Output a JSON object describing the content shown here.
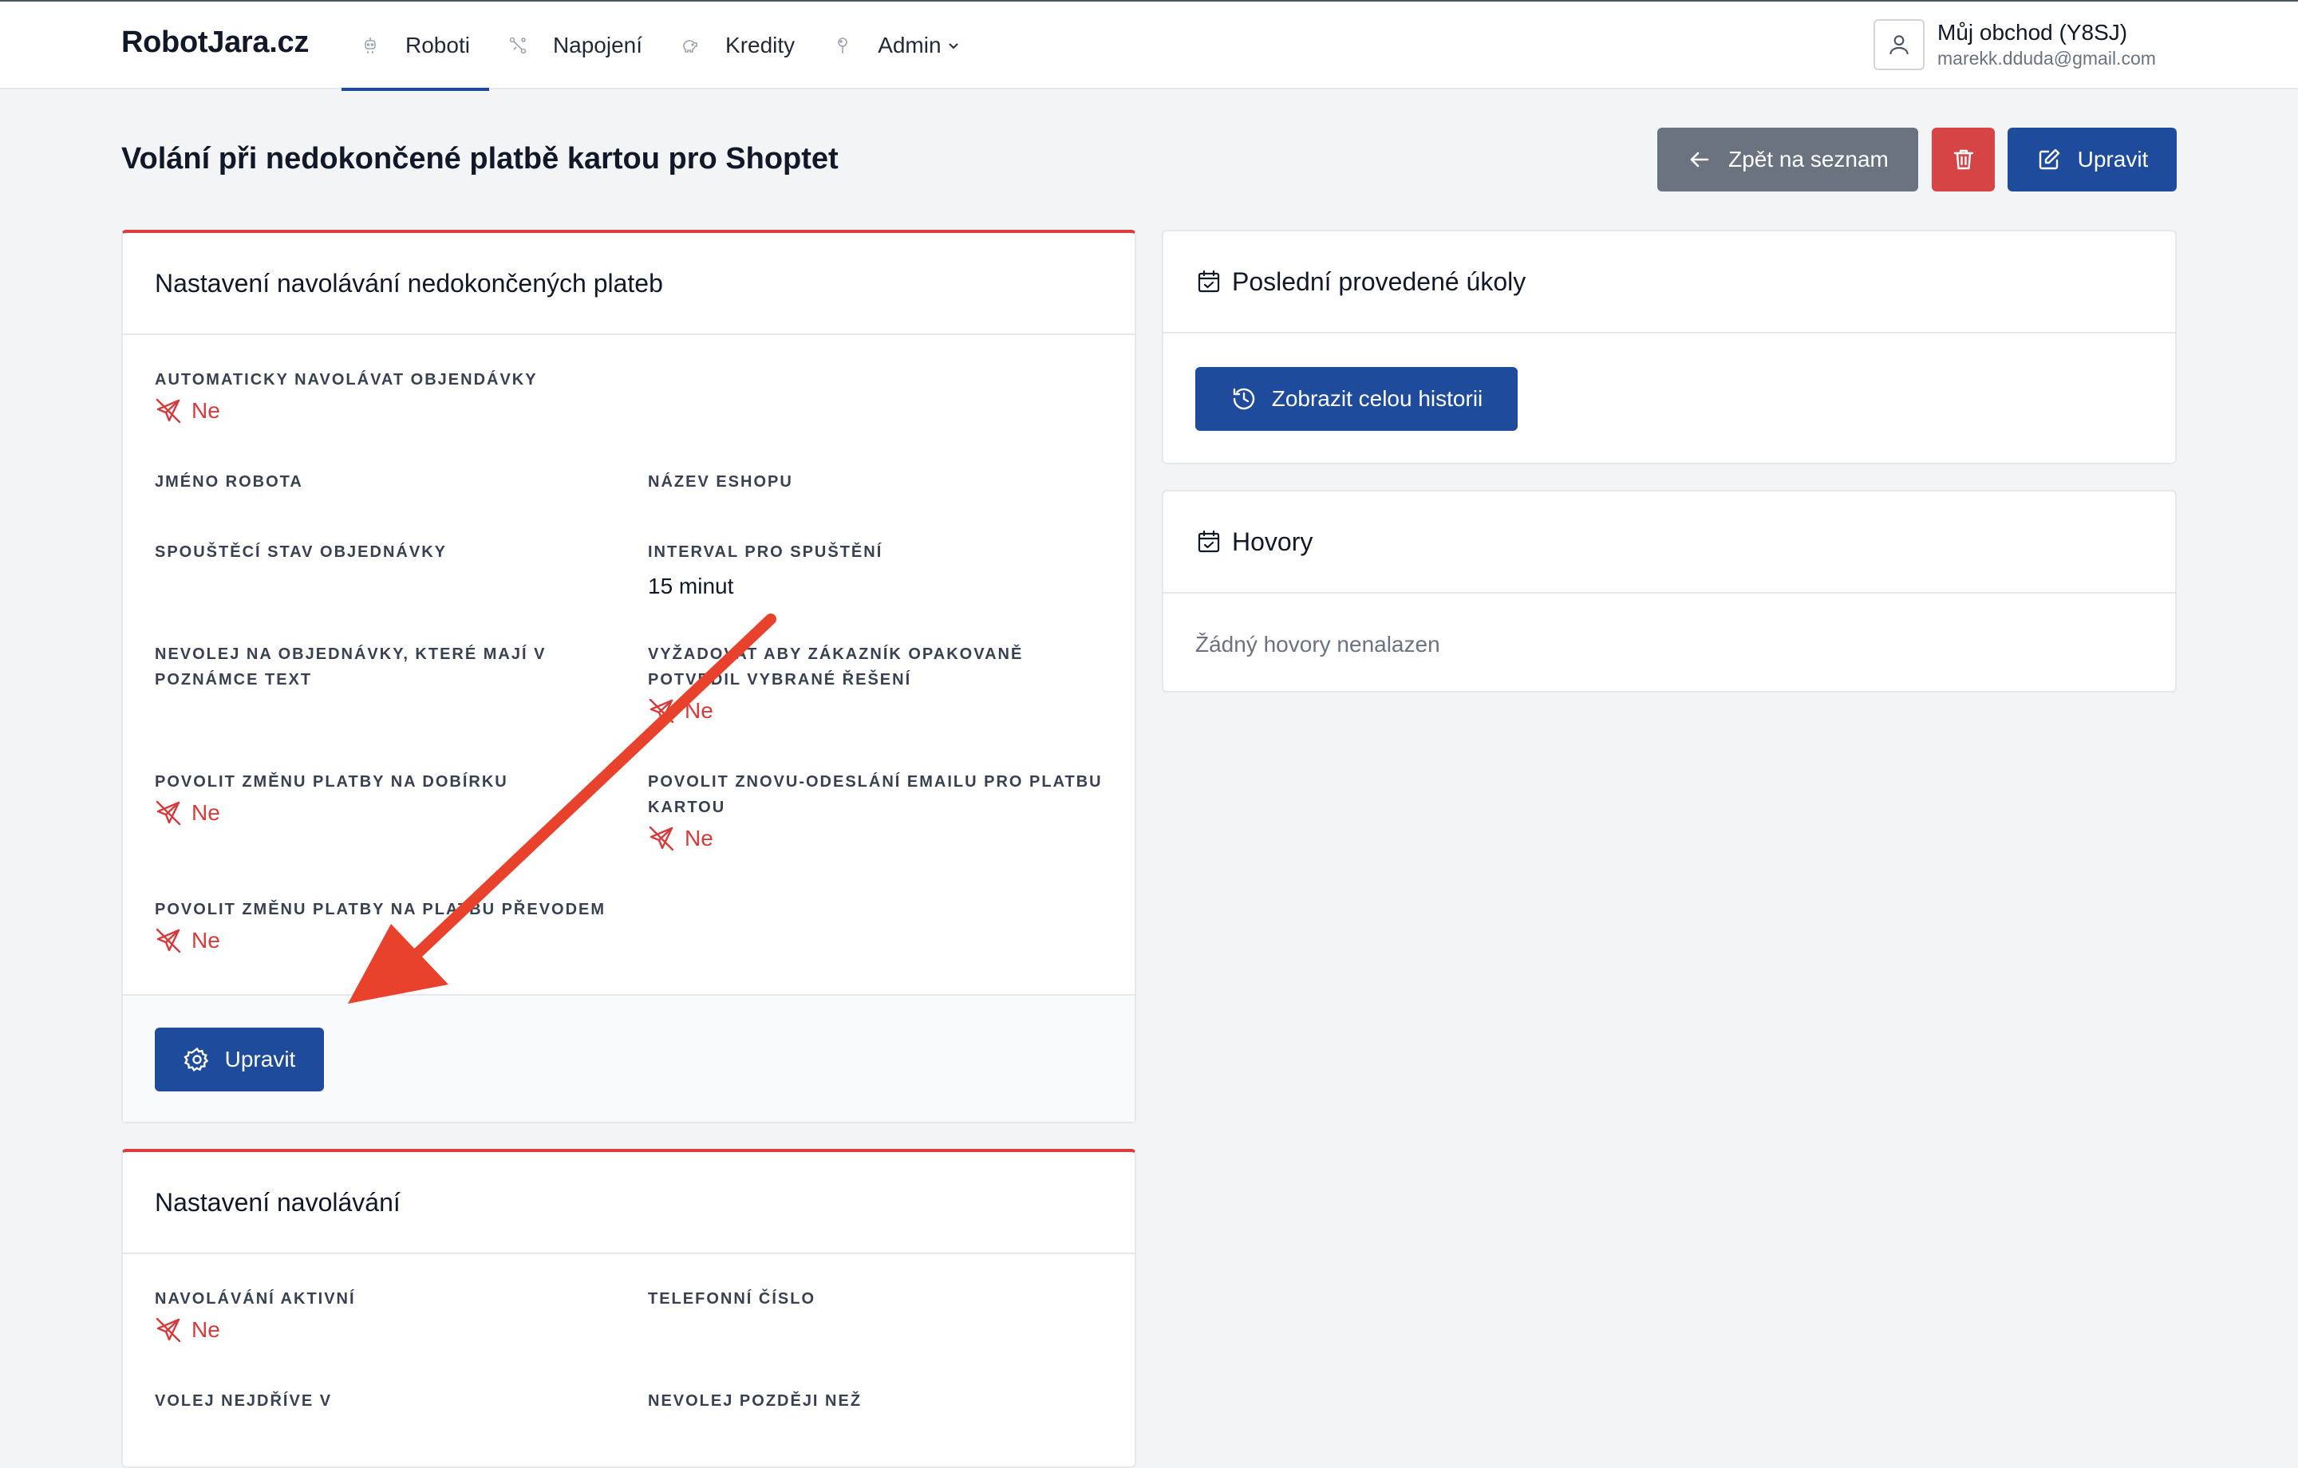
{
  "brand": "RobotJara.cz",
  "nav": {
    "items": [
      {
        "label": "Roboti",
        "icon": "robot-icon",
        "active": true
      },
      {
        "label": "Napojení",
        "icon": "connection-icon"
      },
      {
        "label": "Kredity",
        "icon": "piggy-bank-icon"
      },
      {
        "label": "Admin",
        "icon": "pin-icon",
        "dropdown": true
      }
    ]
  },
  "user": {
    "name": "Můj obchod (Y8SJ)",
    "email": "marekk.dduda@gmail.com"
  },
  "page": {
    "title": "Volání při nedokončené platbě kartou pro Shoptet",
    "back_label": "Zpět na seznam",
    "edit_label": "Upravit"
  },
  "settings_card": {
    "title": "Nastavení navolávání nedokončených plateb",
    "fields": {
      "auto_call": {
        "label": "Automaticky navolávat objendávky",
        "value": "Ne"
      },
      "robot_name": {
        "label": "Jméno robota",
        "value": ""
      },
      "eshop_name": {
        "label": "Název eshopu",
        "value": ""
      },
      "trigger_state": {
        "label": "Spouštěcí stav objednávky",
        "value": ""
      },
      "interval": {
        "label": "Interval pro spuštění",
        "value": "15 minut"
      },
      "skip_note": {
        "label": "Nevolej na objednávky, které mají v poznámce text",
        "value": ""
      },
      "require_confirm": {
        "label": "Vyžadovat aby zákazník opakovaně potvrdil vybrané řešení",
        "value": "Ne"
      },
      "allow_cod": {
        "label": "Povolit změnu platby na dobírku",
        "value": "Ne"
      },
      "allow_resend": {
        "label": "Povolit znovu-odeslání emailu pro platbu kartou",
        "value": "Ne"
      },
      "allow_transfer": {
        "label": "Povolit změnu platby na platbu převodem",
        "value": "Ne"
      }
    },
    "button_label": "Upravit"
  },
  "calling_card": {
    "title": "Nastavení navolávání",
    "fields": {
      "active": {
        "label": "Navolávání aktivní",
        "value": "Ne"
      },
      "phone": {
        "label": "Telefonní číslo",
        "value": ""
      },
      "call_from": {
        "label": "Volej nejdříve v",
        "value": ""
      },
      "call_until": {
        "label": "Nevolej později než",
        "value": ""
      }
    }
  },
  "tasks_card": {
    "title": "Poslední provedené úkoly",
    "button_label": "Zobrazit celou historii"
  },
  "calls_card": {
    "title": "Hovory",
    "empty_text": "Žádný hovory nenalazen"
  },
  "colors": {
    "primary": "#1e4b9c",
    "danger": "#d64545",
    "secondary": "#6b7280",
    "annotation_arrow": "#e8422c"
  }
}
